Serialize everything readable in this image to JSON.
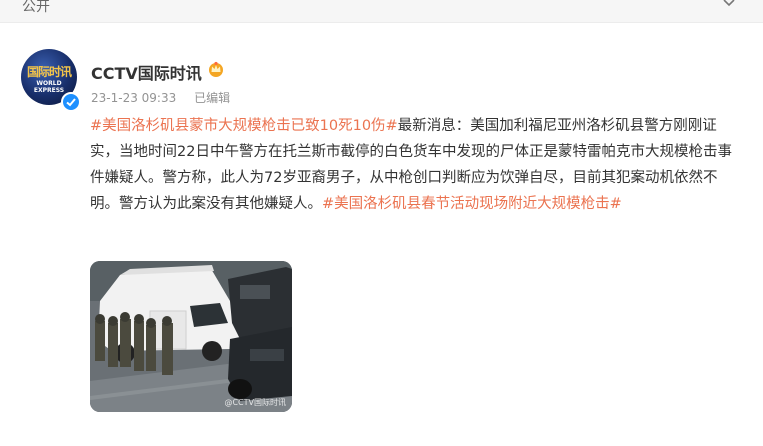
{
  "topbar": {
    "visibility": "公开",
    "expand_icon": "chevron-down-icon"
  },
  "post": {
    "author": "CCTV国际时讯",
    "avatar_text": "国际时讯",
    "avatar_subtext": "WORLD EXPRESS",
    "timestamp": "23-1-23 09:33",
    "edited": "已编辑",
    "hashtag1": "#美国洛杉矶县蒙市大规模枪击已致10死10伤#",
    "body": "最新消息：美国加利福尼亚州洛杉矶县警方刚刚证实，当地时间22日中午警方在托兰斯市截停的白色货车中发现的尸体正是蒙特雷帕克市大规模枪击事件嫌疑人。警方称，此人为72岁亚裔男子，从中枪创口判断应为饮弹自尽，目前其犯案动机依然不明。警方认为此案没有其他嫌疑人。",
    "hashtag2": "#美国洛杉矶县春节活动现场附近大规模枪击#",
    "image_watermark": "@CCTV国际时讯"
  },
  "colors": {
    "tag": "#eb7350",
    "verified": "#1e90ff",
    "meta": "#939393"
  }
}
